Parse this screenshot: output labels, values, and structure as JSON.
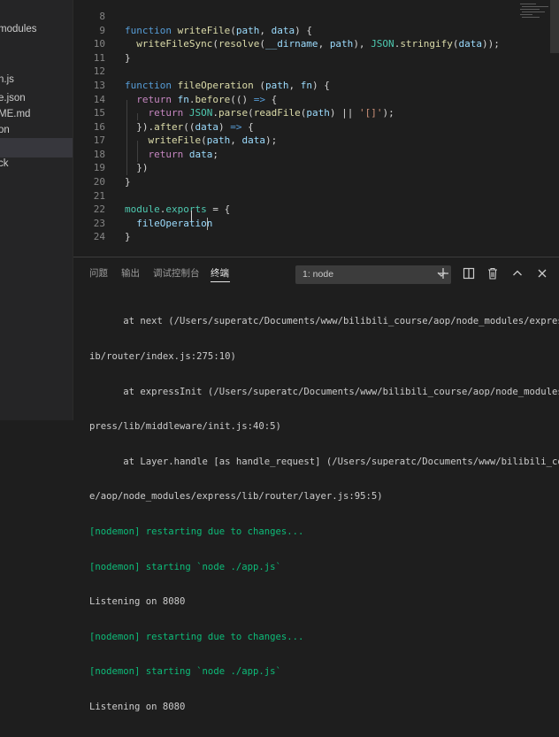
{
  "sidebar": {
    "items": [
      {
        "label": "modules",
        "selected": false
      },
      {
        "label": "n.js",
        "selected": false
      },
      {
        "label": "e.json",
        "selected": false
      },
      {
        "label": "ME.md",
        "selected": false
      },
      {
        "label": "on",
        "selected": false
      },
      {
        "label": "",
        "selected": true
      },
      {
        "label": "ck",
        "selected": false
      }
    ]
  },
  "editor": {
    "line_numbers": [
      "8",
      "9",
      "10",
      "11",
      "12",
      "13",
      "14",
      "15",
      "16",
      "17",
      "18",
      "19",
      "20",
      "21",
      "22",
      "23",
      "24"
    ]
  },
  "panel": {
    "tabs": [
      "问题",
      "输出",
      "调试控制台",
      "终端"
    ],
    "active_tab": "终端",
    "terminal_select": "1: node",
    "terminal_lines": [
      {
        "text": "      at next (/Users/superatc/Documents/www/bilibili_course/aop/node_modules/express/l",
        "kind": "normal"
      },
      {
        "text": "ib/router/index.js:275:10)",
        "kind": "normal"
      },
      {
        "text": "      at expressInit (/Users/superatc/Documents/www/bilibili_course/aop/node_modules/ex",
        "kind": "normal"
      },
      {
        "text": "press/lib/middleware/init.js:40:5)",
        "kind": "normal"
      },
      {
        "text": "      at Layer.handle [as handle_request] (/Users/superatc/Documents/www/bilibili_cours",
        "kind": "normal"
      },
      {
        "text": "e/aop/node_modules/express/lib/router/layer.js:95:5)",
        "kind": "normal"
      },
      {
        "text": "[nodemon] restarting due to changes...",
        "kind": "green"
      },
      {
        "text": "[nodemon] starting `node ./app.js`",
        "kind": "green"
      },
      {
        "text": "Listening on 8080",
        "kind": "normal"
      },
      {
        "text": "[nodemon] restarting due to changes...",
        "kind": "green"
      },
      {
        "text": "[nodemon] starting `node ./app.js`",
        "kind": "green"
      },
      {
        "text": "Listening on 8080",
        "kind": "normal"
      }
    ]
  },
  "icons": {
    "add": "plus-icon",
    "split": "split-terminal-icon",
    "trash": "trash-icon",
    "maximize": "chevron-up-icon",
    "close": "close-icon"
  },
  "colors": {
    "background": "#1e1e1e",
    "sidebar": "#252526",
    "keyword": "#569cd6",
    "function": "#dcdcaa",
    "string": "#ce9178",
    "nodemon_green": "#0dbc79"
  }
}
